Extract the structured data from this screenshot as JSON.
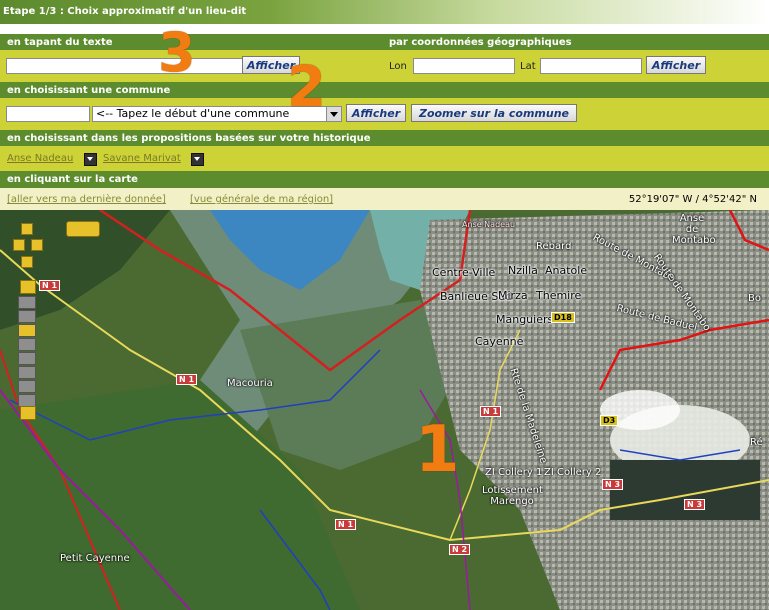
{
  "step_title": "Etape 1/3 : Choix approximatif d'un lieu-dit",
  "text_search": {
    "heading": "en tapant du texte",
    "value": "",
    "button": "Afficher"
  },
  "geo_search": {
    "heading": "par coordonnées géographiques",
    "lon_label": "Lon",
    "lat_label": "Lat",
    "lon_value": "",
    "lat_value": "",
    "button": "Afficher"
  },
  "commune": {
    "heading": "en choisissant une commune",
    "input_value": "",
    "select_value": "<-- Tapez le début d'une commune",
    "show_button": "Afficher",
    "zoom_button": "Zoomer sur la commune"
  },
  "history": {
    "heading": "en choisissant dans les propositions basées sur votre historique",
    "items": [
      "Anse Nadeau",
      "Savane Marivat"
    ]
  },
  "map_section": {
    "heading": "en cliquant sur la carte",
    "link_last": "[aller vers ma dernière donnée]",
    "link_region": "[vue générale de ma région]",
    "coordinates": "52°19'07\" W / 4°52'42\" N"
  },
  "map_labels": {
    "places": [
      "Macouria",
      "Cayenne",
      "Petit Cayenne",
      "Rebard",
      "Centre-Ville",
      "Nzilla",
      "Anatole",
      "Banlieue Sud",
      "Mirza",
      "Themire",
      "Manguiers",
      "ZI Collery 1",
      "ZI Collery 2",
      "Lotissement Marengo",
      "Anse de Montabo",
      "Anse Nadeau",
      "Bo",
      "Ré"
    ],
    "roads": [
      "Route de Montabo",
      "Route de Baduel",
      "Rte de la Madeleine",
      "Route de Montabo"
    ],
    "shields": [
      "N 1",
      "N 1",
      "N 1",
      "N 1",
      "N 2",
      "N 3",
      "N 3",
      "D18",
      "D3"
    ]
  },
  "annotations": [
    "3",
    "2",
    "1"
  ],
  "colors": {
    "section_header": "#5d8c2f",
    "section_row": "#cdd336",
    "annotation": "#f07c12",
    "button_text": "#1a3a80"
  },
  "icons": [
    "pan-up-icon",
    "pan-left-icon",
    "pan-right-icon",
    "pan-down-icon",
    "zoom-in-icon",
    "zoom-out-icon",
    "layers-icon"
  ]
}
